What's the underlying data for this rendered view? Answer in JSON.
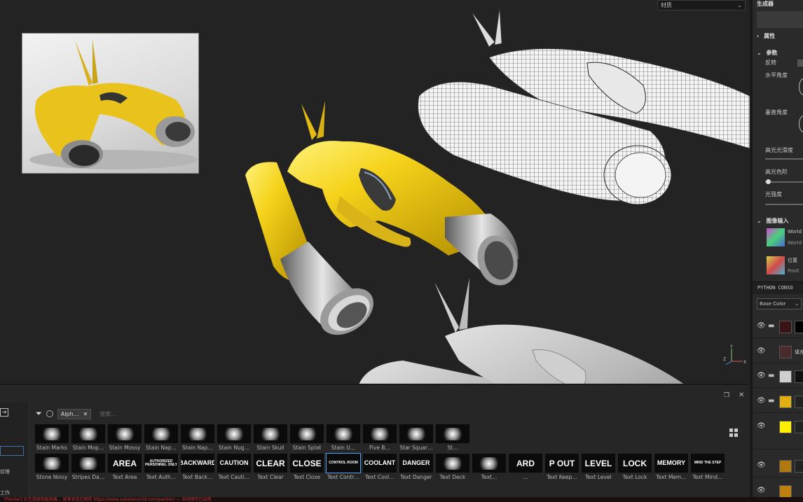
{
  "viewport": {
    "dropdown_value": "材质",
    "gizmo": {
      "y": "Y",
      "x": "X",
      "z": "Z"
    }
  },
  "right_panel": {
    "title": "生成器",
    "sections": {
      "properties": "属性",
      "params": "参数",
      "image_inputs": "图像输入"
    },
    "params": {
      "invert": "反转",
      "horizontal_angle": "水平角度",
      "vertical_angle": "垂直角度",
      "highlight_smoothness": "高光光滑度",
      "highlight_color": "高光色阶",
      "light_intensity": "光强度"
    },
    "inputs": [
      {
        "name": "World",
        "sub": "World"
      },
      {
        "name": "位置",
        "sub": "Posit"
      }
    ],
    "python_console": "PYTHON CONSO",
    "blend_mode": "Base Color",
    "layer_label": "填充"
  },
  "shelf": {
    "filter_tag": "Alph…",
    "search_placeholder": "搜索…",
    "row1": [
      {
        "label": "Stain Marks"
      },
      {
        "label": "Stain Mop…"
      },
      {
        "label": "Stain Mossy"
      },
      {
        "label": "Stain Nap…"
      },
      {
        "label": "Stain Nap…"
      },
      {
        "label": "Stain Nug…"
      },
      {
        "label": "Stain Skull"
      },
      {
        "label": "Stain Splat"
      },
      {
        "label": "Stain U…"
      },
      {
        "label": "Five B…"
      },
      {
        "label": "Star Squar…"
      },
      {
        "label": "St…"
      }
    ],
    "row2": [
      {
        "label": "Stone Noisy",
        "thumb": ""
      },
      {
        "label": "Stripes Da…",
        "thumb": ""
      },
      {
        "label": "Text Area",
        "thumb": "AREA"
      },
      {
        "label": "Text Auth…",
        "thumb": "AUTHORIZED PERSONNEL ONLY"
      },
      {
        "label": "Text Back…",
        "thumb": "BACKWARD"
      },
      {
        "label": "Text Cauti…",
        "thumb": "CAUTION"
      },
      {
        "label": "Text Clear",
        "thumb": "CLEAR"
      },
      {
        "label": "Text Close",
        "thumb": "CLOSE"
      },
      {
        "label": "Text Contr…",
        "thumb": "CONTROL ROOM"
      },
      {
        "label": "Text Cool…",
        "thumb": "COOLANT"
      },
      {
        "label": "Text Danger",
        "thumb": "DANGER"
      },
      {
        "label": "Text Deck",
        "thumb": ""
      },
      {
        "label": "Text…",
        "thumb": ""
      },
      {
        "label": "…",
        "thumb": "ARD"
      },
      {
        "label": "Text Keep…",
        "thumb": "P OUT"
      },
      {
        "label": "Text Level",
        "thumb": "LEVEL"
      },
      {
        "label": "Text Lock",
        "thumb": "LOCK"
      },
      {
        "label": "Text Mem…",
        "thumb": "MEMORY"
      },
      {
        "label": "Text Mind…",
        "thumb": "MIND THE STEP"
      }
    ],
    "side_labels": [
      "纹理",
      "工作"
    ]
  },
  "status_bar": {
    "text": "[Painter] 正在连接到服务器… 登录状态已保存 https://www.substance3d.com/painter/ — 自动保存已启用"
  },
  "colors": {
    "yellow": "#f5d21a",
    "accent": "#4aa3ff",
    "status_red": "#c63a3a"
  }
}
